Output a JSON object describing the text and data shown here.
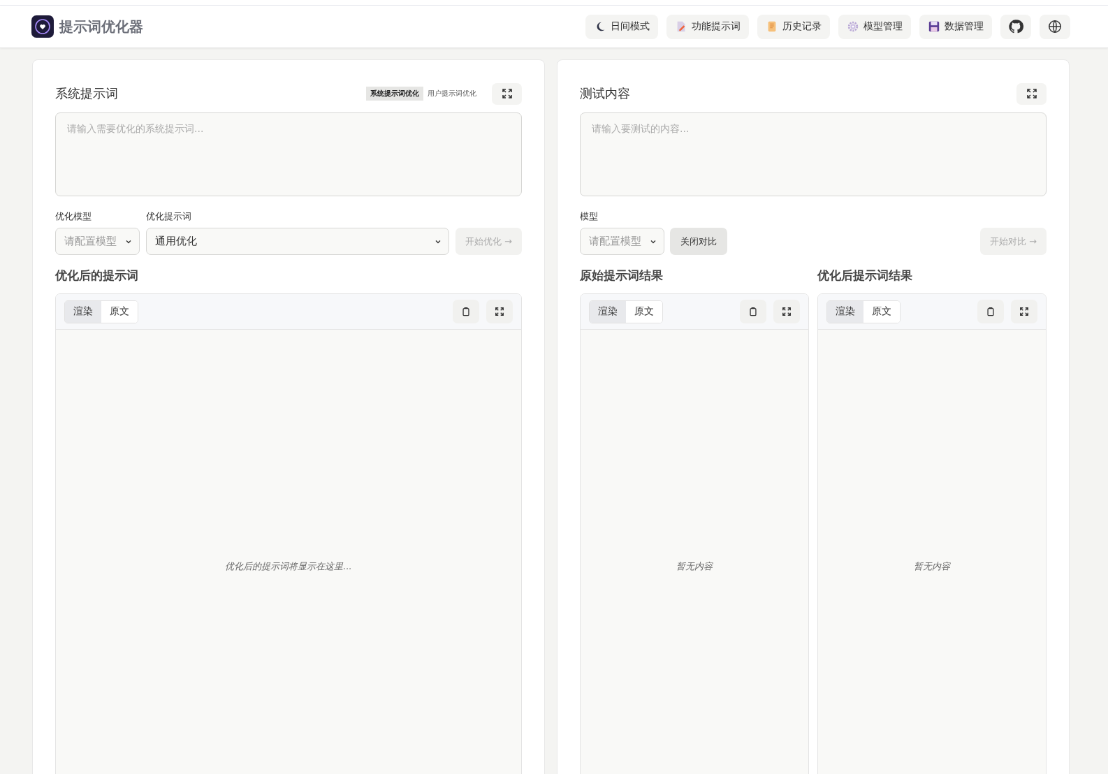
{
  "header": {
    "title": "提示词优化器",
    "nav": [
      {
        "kind": "moon",
        "label": "日间模式"
      },
      {
        "kind": "document",
        "label": "功能提示词"
      },
      {
        "kind": "scroll",
        "label": "历史记录"
      },
      {
        "kind": "gear",
        "label": "模型管理"
      },
      {
        "kind": "floppy",
        "label": "数据管理"
      }
    ],
    "icon_buttons": [
      {
        "kind": "github"
      },
      {
        "kind": "globe"
      }
    ]
  },
  "optimize_panel": {
    "title": "系统提示词",
    "mode_tabs": [
      {
        "label": "系统提示词优化",
        "selected": true
      },
      {
        "label": "用户提示词优化",
        "selected": false
      }
    ],
    "input": {
      "placeholder": "请输入需要优化的系统提示词..."
    },
    "model_label": "优化模型",
    "model_select": {
      "placeholder": "请配置模型"
    },
    "template_label": "优化提示词",
    "template_select": {
      "value": "通用优化"
    },
    "start_button": {
      "label": "开始优化 →",
      "disabled": true
    },
    "output": {
      "title": "优化后的提示词",
      "view_tabs": [
        {
          "label": "渲染",
          "selected": true
        },
        {
          "label": "原文",
          "selected": false
        }
      ],
      "empty_message": "优化后的提示词将显示在这里..."
    }
  },
  "test_panel": {
    "title": "测试内容",
    "input": {
      "placeholder": "请输入要测试的内容..."
    },
    "model_label": "模型",
    "model_select": {
      "placeholder": "请配置模型"
    },
    "compare_button": {
      "label": "关闭对比"
    },
    "start_button": {
      "label": "开始对比 →",
      "disabled": true
    },
    "results": [
      {
        "title": "原始提示词结果",
        "view_tabs": [
          {
            "label": "渲染",
            "selected": true
          },
          {
            "label": "原文",
            "selected": false
          }
        ],
        "empty_message": "暂无内容"
      },
      {
        "title": "优化后提示词结果",
        "view_tabs": [
          {
            "label": "渲染",
            "selected": true
          },
          {
            "label": "原文",
            "selected": false
          }
        ],
        "empty_message": "暂无内容"
      }
    ]
  }
}
